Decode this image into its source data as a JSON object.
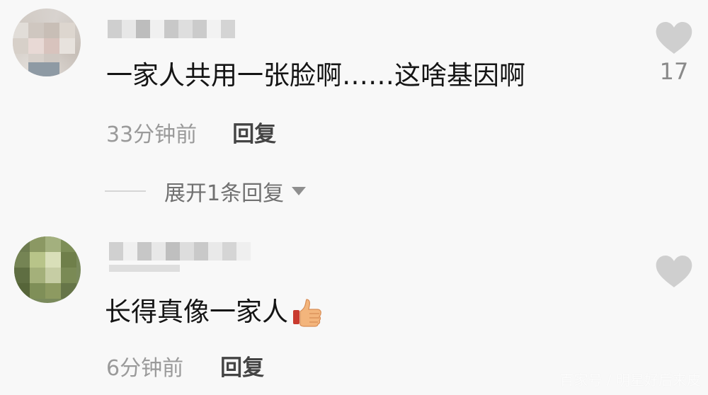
{
  "comments": [
    {
      "text": "一家人共用一张脸啊……这啥基因啊",
      "time": "33分钟前",
      "reply_label": "回复",
      "likes": "17",
      "expand_label": "展开1条回复"
    },
    {
      "text": "长得真像一家人",
      "time": "6分钟前",
      "reply_label": "回复",
      "likes": ""
    }
  ],
  "icons": {
    "like": "heart-icon",
    "expand": "caret-down-icon",
    "emoji": "thumbs-up-emoji"
  },
  "colors": {
    "background": "#f8f8f8",
    "text": "#151515",
    "meta": "#9a9a9a",
    "heart": "#cfcfcf"
  },
  "watermark": "百家号 / 明星好后来皮"
}
